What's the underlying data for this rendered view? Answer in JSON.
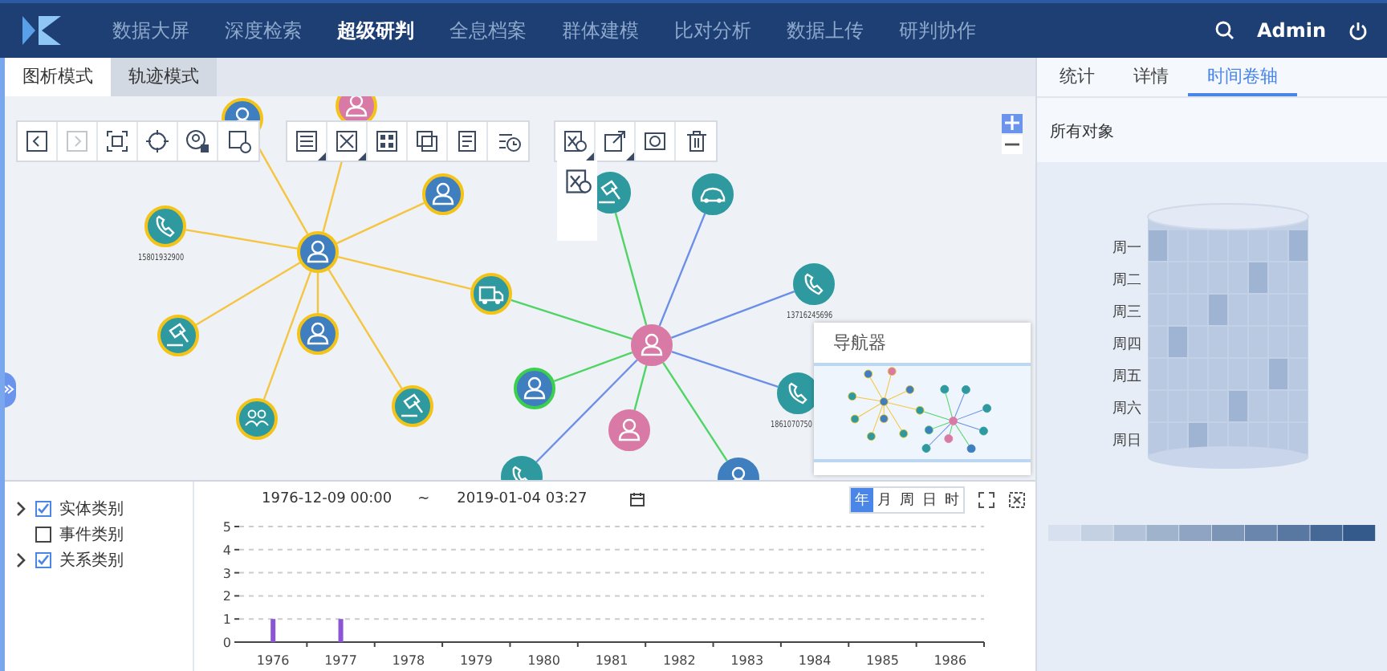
{
  "header": {
    "nav": [
      {
        "label": "数据大屏",
        "selected": false
      },
      {
        "label": "深度检索",
        "selected": false
      },
      {
        "label": "超级研判",
        "selected": true
      },
      {
        "label": "全息档案",
        "selected": false
      },
      {
        "label": "群体建模",
        "selected": false
      },
      {
        "label": "比对分析",
        "selected": false
      },
      {
        "label": "数据上传",
        "selected": false
      },
      {
        "label": "研判协作",
        "selected": false
      }
    ],
    "user": "Admin"
  },
  "mode_tabs": [
    {
      "label": "图析模式",
      "selected": true
    },
    {
      "label": "轨迹模式",
      "selected": false
    }
  ],
  "toolbar": {
    "groups": [
      [
        {
          "kind": "back",
          "disabled": false,
          "menu": false
        },
        {
          "kind": "forward",
          "disabled": true,
          "menu": false
        },
        {
          "kind": "frame",
          "disabled": false,
          "menu": false
        },
        {
          "kind": "target",
          "disabled": false,
          "menu": false
        },
        {
          "kind": "badge",
          "disabled": false,
          "menu": false
        },
        {
          "kind": "device",
          "disabled": false,
          "menu": false
        }
      ],
      [
        {
          "kind": "list",
          "disabled": false,
          "menu": true
        },
        {
          "kind": "expand",
          "disabled": false,
          "menu": true
        },
        {
          "kind": "cluster",
          "disabled": false,
          "menu": false
        },
        {
          "kind": "swap",
          "disabled": false,
          "menu": false
        },
        {
          "kind": "notes",
          "disabled": false,
          "menu": false
        },
        {
          "kind": "history",
          "disabled": false,
          "menu": false
        }
      ],
      [
        {
          "kind": "sheet",
          "disabled": false,
          "menu": true
        },
        {
          "kind": "export",
          "disabled": false,
          "menu": true
        },
        {
          "kind": "camera",
          "disabled": false,
          "menu": false
        },
        {
          "kind": "trash",
          "disabled": false,
          "menu": false
        }
      ]
    ],
    "dropdown": [
      {
        "kind": "sheet"
      }
    ]
  },
  "graph": {
    "nodes": [
      {
        "kind": "person",
        "color": "#3f7fbf",
        "highlighted": true,
        "selected": false
      },
      {
        "kind": "person",
        "color": "#3f7fbf",
        "highlighted": true,
        "selected": false
      },
      {
        "kind": "phone",
        "color": "#2e9aa0",
        "highlighted": true,
        "selected": false,
        "label": "15801932900"
      },
      {
        "kind": "truck",
        "color": "#2e9aa0",
        "highlighted": true,
        "selected": false
      },
      {
        "kind": "hammer",
        "color": "#2e9aa0",
        "highlighted": true,
        "selected": false
      },
      {
        "kind": "person",
        "color": "#3f7fbf",
        "highlighted": true,
        "selected": false
      },
      {
        "kind": "group",
        "color": "#2e9aa0",
        "highlighted": true,
        "selected": false
      },
      {
        "kind": "hammer",
        "color": "#2e9aa0",
        "highlighted": true,
        "selected": false
      },
      {
        "kind": "person",
        "color": "#3f7fbf",
        "highlighted": true,
        "selected": false
      },
      {
        "kind": "person",
        "color": "#d97aa6",
        "highlighted": true,
        "selected": false
      },
      {
        "kind": "person",
        "color": "#d97aa6",
        "highlighted": false,
        "selected": false
      },
      {
        "kind": "hammer",
        "color": "#2e9aa0",
        "highlighted": false,
        "selected": false
      },
      {
        "kind": "car",
        "color": "#2e9aa0",
        "highlighted": false,
        "selected": false
      },
      {
        "kind": "phone",
        "color": "#2e9aa0",
        "highlighted": false,
        "selected": false,
        "label": "13716245696"
      },
      {
        "kind": "phone",
        "color": "#2e9aa0",
        "highlighted": false,
        "selected": false,
        "label": "1861070750"
      },
      {
        "kind": "person",
        "color": "#3f7fbf",
        "highlighted": false,
        "selected": true
      },
      {
        "kind": "person",
        "color": "#d97aa6",
        "highlighted": false,
        "selected": false
      },
      {
        "kind": "phone",
        "color": "#2e9aa0",
        "highlighted": false,
        "selected": false
      },
      {
        "kind": "person",
        "color": "#3f7fbf",
        "highlighted": false,
        "selected": false
      }
    ]
  },
  "navigator": {
    "title": "导航器"
  },
  "filters": [
    {
      "label": "实体类别",
      "checked": true,
      "expandable": true
    },
    {
      "label": "事件类别",
      "checked": false,
      "expandable": false
    },
    {
      "label": "关系类别",
      "checked": true,
      "expandable": true
    }
  ],
  "timeline": {
    "start": "1976-12-09 00:00",
    "separator": "~",
    "end": "2019-01-04 03:27",
    "units": [
      {
        "label": "年",
        "selected": true
      },
      {
        "label": "月",
        "selected": false
      },
      {
        "label": "周",
        "selected": false
      },
      {
        "label": "日",
        "selected": false
      },
      {
        "label": "时",
        "selected": false
      }
    ],
    "chart_data": {
      "type": "bar",
      "categories": [
        "1976",
        "1977",
        "1978",
        "1979",
        "1980",
        "1981",
        "1982",
        "1983",
        "1984",
        "1985",
        "1986"
      ],
      "values": [
        1,
        1,
        0,
        0,
        0,
        0,
        0,
        0,
        0,
        0,
        0
      ],
      "grid": true,
      "ylim": [
        0,
        5
      ],
      "yticks": [
        0,
        1,
        2,
        3,
        4,
        5
      ]
    }
  },
  "side_panel": {
    "tabs": [
      {
        "label": "统计",
        "selected": false
      },
      {
        "label": "详情",
        "selected": false
      },
      {
        "label": "时间卷轴",
        "selected": true
      }
    ],
    "subtitle": "所有对象",
    "days": [
      "周一",
      "周二",
      "周三",
      "周四",
      "周五",
      "周六",
      "周日"
    ]
  }
}
